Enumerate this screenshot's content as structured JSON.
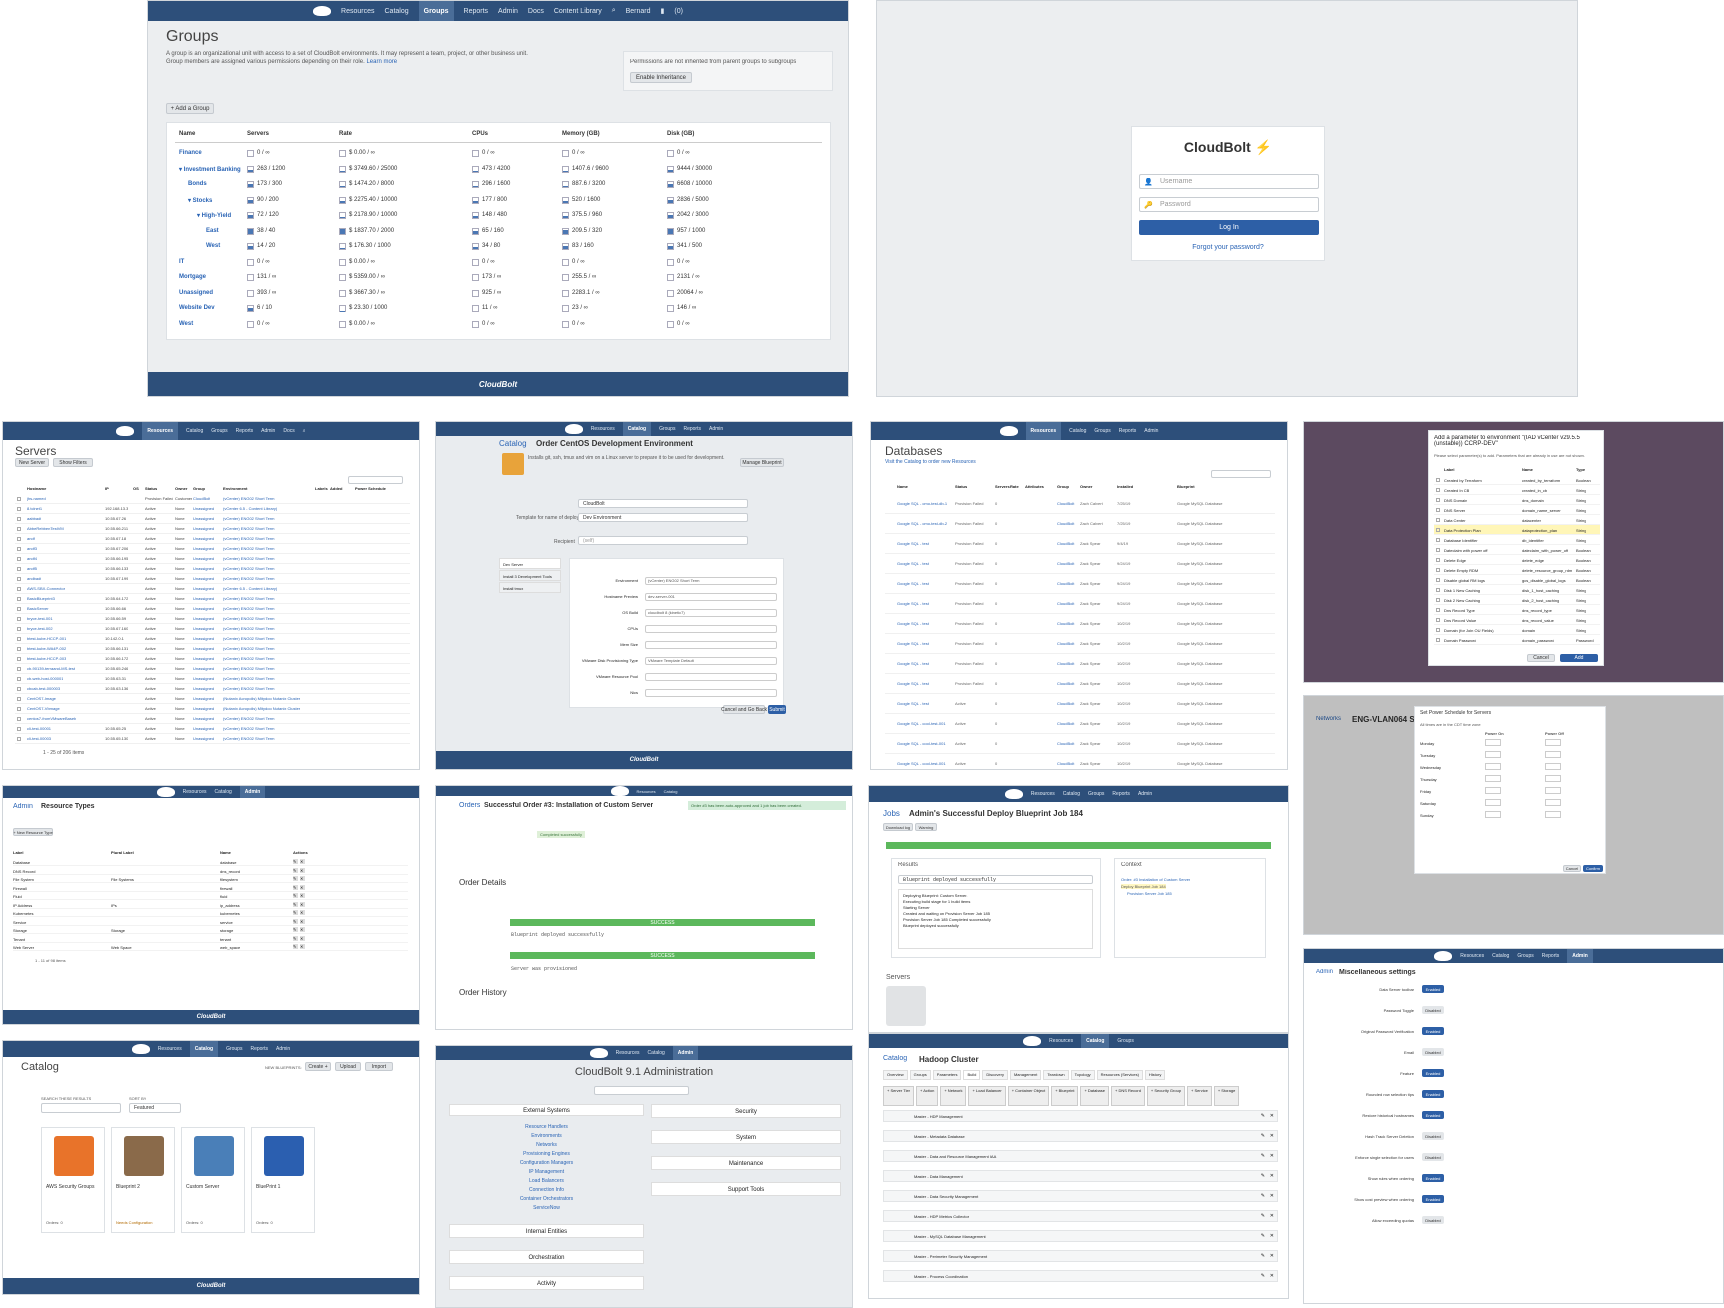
{
  "groups": {
    "nav": [
      "Resources",
      "Catalog",
      "Groups",
      "Reports",
      "Admin",
      "Docs",
      "Content Library",
      "Bernard",
      "(0)"
    ],
    "title": "Groups",
    "desc": "A group is an organizational unit with access to a set of CloudBolt environments. It may represent a team, project, or other business unit. Group members are assigned various permissions depending on their role.",
    "learn_more": "Learn more",
    "perm_note": "Permissions are not inherited from parent groups to subgroups",
    "enable_label": "Enable Inheritance",
    "add_label": "+ Add a Group",
    "headers": [
      "Name",
      "Servers",
      "Rate",
      "CPUs",
      "Memory (GB)",
      "Disk (GB)"
    ],
    "rows": [
      {
        "name": "Finance",
        "indent": 0,
        "servers": "0 / ∞",
        "rate": "$ 0.00 / ∞",
        "cpus": "0 / ∞",
        "mem": "0 / ∞",
        "disk": "0 / ∞"
      },
      {
        "name": "▾ Investment Banking",
        "indent": 0,
        "servers": "263 / 1200",
        "rate": "$ 3749.60 / 25000",
        "cpus": "473 / 4200",
        "mem": "1407.6 / 9600",
        "disk": "9444 / 30000"
      },
      {
        "name": "Bonds",
        "indent": 1,
        "servers": "173 / 300",
        "rate": "$ 1474.20 / 8000",
        "cpus": "296 / 1600",
        "mem": "887.6 / 3200",
        "disk": "6608 / 10000"
      },
      {
        "name": "▾ Stocks",
        "indent": 1,
        "servers": "90 / 200",
        "rate": "$ 2275.40 / 10000",
        "cpus": "177 / 800",
        "mem": "520 / 1600",
        "disk": "2836 / 5000"
      },
      {
        "name": "▾ High-Yield",
        "indent": 2,
        "servers": "72 / 120",
        "rate": "$ 2178.90 / 10000",
        "cpus": "148 / 480",
        "mem": "375.5 / 960",
        "disk": "2042 / 3000"
      },
      {
        "name": "East",
        "indent": 3,
        "servers": "38 / 40",
        "rate": "$ 1837.70 / 2000",
        "cpus": "65 / 160",
        "mem": "209.5 / 320",
        "disk": "957 / 1000"
      },
      {
        "name": "West",
        "indent": 3,
        "servers": "14 / 20",
        "rate": "$ 176.30 / 1000",
        "cpus": "34 / 80",
        "mem": "83 / 160",
        "disk": "341 / 500"
      },
      {
        "name": "IT",
        "indent": 0,
        "servers": "0 / ∞",
        "rate": "$ 0.00 / ∞",
        "cpus": "0 / ∞",
        "mem": "0 / ∞",
        "disk": "0 / ∞"
      },
      {
        "name": "Mortgage",
        "indent": 0,
        "servers": "131 / ∞",
        "rate": "$ 5359.00 / ∞",
        "cpus": "173 / ∞",
        "mem": "255.5 / ∞",
        "disk": "2131 / ∞"
      },
      {
        "name": "Unassigned",
        "indent": 0,
        "servers": "393 / ∞",
        "rate": "$ 3667.30 / ∞",
        "cpus": "925 / ∞",
        "mem": "2283.1 / ∞",
        "disk": "20064 / ∞"
      },
      {
        "name": "Website Dev",
        "indent": 0,
        "servers": "6 / 10",
        "rate": "$ 23.30 / 1000",
        "cpus": "11 / ∞",
        "mem": "23 / ∞",
        "disk": "146 / ∞"
      },
      {
        "name": "West",
        "indent": 0,
        "servers": "0 / ∞",
        "rate": "$ 0.00 / ∞",
        "cpus": "0 / ∞",
        "mem": "0 / ∞",
        "disk": "0 / ∞"
      }
    ],
    "footer": "CloudBolt"
  },
  "login": {
    "brand": "CloudBolt",
    "username": "Username",
    "password": "Password",
    "submit": "Log In",
    "forgot": "Forgot your password?"
  },
  "servers": {
    "title": "Servers",
    "new": "New Server",
    "filters": "Show Filters",
    "pager": "1 - 25 of 206 items",
    "cols": [
      "Hostname",
      "IP",
      "OS",
      "Status",
      "Owner",
      "Group",
      "Environment",
      "Labels",
      "Added",
      "Power Schedule"
    ],
    "rows": [
      [
        "jhs-named",
        "",
        "",
        "Provision Failed",
        "Customer",
        "CloudBolt",
        "(vCenter) ENG02 Short Term"
      ],
      [
        "8.tclnet1",
        "192.168.13.3",
        "",
        "Active",
        "None",
        "Unassigned",
        "(vCenter 6.5 - Content Library)"
      ],
      [
        "aabbadf",
        "10.55.67.26",
        "",
        "Active",
        "None",
        "Unassigned",
        "(vCenter) ENG02 Short Term"
      ],
      [
        "AbbeRebbenTestVM",
        "10.55.66.211",
        "",
        "Active",
        "None",
        "Unassigned",
        "(vCenter) ENG02 Short Term"
      ],
      [
        "andf",
        "10.55.67.18",
        "",
        "Active",
        "None",
        "Unassigned",
        "(vCenter) ENG02 Short Term"
      ],
      [
        "andf3",
        "10.55.67.206",
        "",
        "Active",
        "None",
        "Unassigned",
        "(vCenter) ENG02 Short Term"
      ],
      [
        "andf4",
        "10.55.66.195",
        "",
        "Active",
        "None",
        "Unassigned",
        "(vCenter) ENG02 Short Term"
      ],
      [
        "andf5",
        "10.55.66.133",
        "",
        "Active",
        "None",
        "Unassigned",
        "(vCenter) ENG02 Short Term"
      ],
      [
        "andbadf",
        "10.55.67.199",
        "",
        "Active",
        "None",
        "Unassigned",
        "(vCenter) ENG02 Short Term"
      ],
      [
        "AWS-SBX-Connector",
        "",
        "",
        "Active",
        "None",
        "Unassigned",
        "(vCenter 6.5 - Content Library)"
      ],
      [
        "BasicBlueprint3",
        "10.55.64.172",
        "",
        "Active",
        "None",
        "Unassigned",
        "(vCenter) ENG02 Short Term"
      ],
      [
        "BasicServer",
        "10.55.66.66",
        "",
        "Active",
        "None",
        "Unassigned",
        "(vCenter) ENG02 Short Term"
      ],
      [
        "bryce-test-001",
        "10.55.66.59",
        "",
        "Active",
        "None",
        "Unassigned",
        "(vCenter) ENG02 Short Term"
      ],
      [
        "bryce-test-002",
        "10.55.67.160",
        "",
        "Active",
        "None",
        "Unassigned",
        "(vCenter) ENG02 Short Term"
      ],
      [
        "btest-kube-HCCP-001",
        "10.142.0.1",
        "",
        "Active",
        "None",
        "Unassigned",
        "(vCenter) ENG02 Short Term"
      ],
      [
        "btest-kube-WA4P-002",
        "10.55.66.131",
        "",
        "Active",
        "None",
        "Unassigned",
        "(vCenter) ENG02 Short Term"
      ],
      [
        "btest-kube-HCCP-003",
        "10.55.66.172",
        "",
        "Active",
        "None",
        "Unassigned",
        "(vCenter) ENG02 Short Term"
      ],
      [
        "cb-90139-terraand-MS-test",
        "10.55.65.246",
        "",
        "Active",
        "None",
        "Unassigned",
        "(vCenter) ENG02 Short Term"
      ],
      [
        "cb-web-host-000001",
        "10.55.63.31",
        "",
        "Active",
        "None",
        "Unassigned",
        "(vCenter) ENG02 Short Term"
      ],
      [
        "cbcab-test-000003",
        "10.55.63.136",
        "",
        "Active",
        "None",
        "Unassigned",
        "(vCenter) ENG02 Short Term"
      ],
      [
        "CentOS7-Image",
        "",
        "",
        "Active",
        "None",
        "Unassigned",
        "(Nutanix Acropolis) Mitydoo Nutanix Cluster"
      ],
      [
        "CentOS7-Vbmage",
        "",
        "",
        "Active",
        "None",
        "Unassigned",
        "(Nutanix Acropolis) Mitydoo Nutanix Cluster"
      ],
      [
        "centos7-fromVMwareBaseb",
        "",
        "",
        "Active",
        "None",
        "Unassigned",
        "(vCenter) ENG02 Short Term"
      ],
      [
        "cli-test-00001",
        "10.55.65.25",
        "",
        "Active",
        "None",
        "Unassigned",
        "(vCenter) ENG02 Short Term"
      ],
      [
        "cli-test-00003",
        "10.55.65.130",
        "",
        "Active",
        "None",
        "Unassigned",
        "(vCenter) ENG02 Short Term"
      ]
    ]
  },
  "order": {
    "crumb": "Catalog",
    "title": "Order CentOS Development Environment",
    "desc": "Installs git, ssh, tmux and vim on a Linux server to prepare it to be used for development.",
    "manage": "Manage Blueprint",
    "group_label": "Group",
    "group_val": "CloudBolt",
    "template_label": "Template for name of deployed Service",
    "template_val": "Dev Environment",
    "recipient_label": "Recipient",
    "recipient_val": "(self)",
    "steps": [
      "Dev Server",
      "Install 3 Development Tools",
      "Install tmux"
    ],
    "fields": [
      "Environment",
      "Hostname Preview",
      "OS Build",
      "CPUs",
      "Mem Size",
      "VMware Disk Provisioning Type",
      "VMware Resource Pool",
      "Nics"
    ],
    "values": [
      "(vCenter) ENG02 Short Term",
      "dev-server-001",
      "cloudbolt 8 (kinetic7)",
      "",
      "",
      "VMware Template Default",
      "",
      ""
    ],
    "cancel": "Cancel and Go Back",
    "submit": "Submit"
  },
  "databases": {
    "title": "Databases",
    "hint": "Visit the Catalog to order new Resources",
    "cols": [
      "Name",
      "Status",
      "Servers",
      "Rate",
      "Attributes",
      "Group",
      "Owner",
      "Installed",
      "Blueprint"
    ],
    "rows": [
      [
        "Google SQL - cmo-test-db-1",
        "Provision Failed",
        "0",
        "CloudBolt",
        "Zach Calvert",
        "7/25/19",
        "Google MySQL Database"
      ],
      [
        "Google SQL - cmo-test-db-2",
        "Provision Failed",
        "0",
        "CloudBolt",
        "Zach Calvert",
        "7/25/19",
        "Google MySQL Database"
      ],
      [
        "Google SQL - test",
        "Provision Failed",
        "0",
        "CloudBolt",
        "Zack Spear",
        "9/4/19",
        "Google MySQL Database"
      ],
      [
        "Google SQL - test",
        "Provision Failed",
        "0",
        "CloudBolt",
        "Zack Spear",
        "9/24/19",
        "Google MySQL Database"
      ],
      [
        "Google SQL - test",
        "Provision Failed",
        "0",
        "CloudBolt",
        "Zack Spear",
        "9/24/19",
        "Google MySQL Database"
      ],
      [
        "Google SQL - test",
        "Provision Failed",
        "0",
        "CloudBolt",
        "Zack Spear",
        "9/24/19",
        "Google MySQL Database"
      ],
      [
        "Google SQL - test",
        "Provision Failed",
        "0",
        "CloudBolt",
        "Zack Spear",
        "10/2/19",
        "Google MySQL Database"
      ],
      [
        "Google SQL - test",
        "Provision Failed",
        "0",
        "CloudBolt",
        "Zack Spear",
        "10/2/19",
        "Google MySQL Database"
      ],
      [
        "Google SQL - test",
        "Provision Failed",
        "0",
        "CloudBolt",
        "Zack Spear",
        "10/2/19",
        "Google MySQL Database"
      ],
      [
        "Google SQL - test",
        "Provision Failed",
        "0",
        "CloudBolt",
        "Zack Spear",
        "10/2/19",
        "Google MySQL Database"
      ],
      [
        "Google SQL - test",
        "Active",
        "0",
        "CloudBolt",
        "Zack Spear",
        "10/2/19",
        "Google MySQL Database"
      ],
      [
        "Google SQL - cool-test-001",
        "Active",
        "0",
        "CloudBolt",
        "Zack Spear",
        "10/2/19",
        "Google MySQL Database"
      ],
      [
        "Google SQL - cool-test-001",
        "Active",
        "0",
        "CloudBolt",
        "Zack Spear",
        "10/2/19",
        "Google MySQL Database"
      ],
      [
        "Google SQL - cool-test-001",
        "Active",
        "0",
        "CloudBolt",
        "Zack Spear",
        "10/2/19",
        "Google MySQL Database"
      ]
    ]
  },
  "param_modal": {
    "title": "Add a parameter to environment \"(IAD vCenter v29.5.5 (unstable)) CCRP-DEV\"",
    "hint": "Please select parameter(s) to add. Parameters that are already in use are not shown.",
    "cols": [
      "Label",
      "Name",
      "Type"
    ],
    "rows": [
      [
        "Created by Terraform",
        "created_by_terraform",
        "Boolean"
      ],
      [
        "Created In CB",
        "created_in_cb",
        "String"
      ],
      [
        "DNS Domain",
        "dns_domain",
        "String"
      ],
      [
        "DNS Server",
        "domain_name_server",
        "String"
      ],
      [
        "Data Center",
        "datacenter",
        "String"
      ],
      [
        "Data Protection Plan",
        "dataprotection_plan",
        "String"
      ],
      [
        "Database Identifier",
        "db_identifier",
        "String"
      ],
      [
        "Dateclaim with power off",
        "dateclaim_with_power_off",
        "Boolean"
      ],
      [
        "Delete Edge",
        "delete_edge",
        "Boolean"
      ],
      [
        "Delete Empty RDM",
        "delete_resource_group_rdm",
        "Boolean"
      ],
      [
        "Disable global RM logs",
        "gcs_disable_global_logs",
        "Boolean"
      ],
      [
        "Disk 1 New Caching",
        "disk_1_host_caching",
        "String"
      ],
      [
        "Disk 2 New Caching",
        "disk_2_host_caching",
        "String"
      ],
      [
        "Dns Record Type",
        "dns_record_type",
        "String"
      ],
      [
        "Dns Record Value",
        "dns_record_value",
        "String"
      ],
      [
        "Domain (for Join OU Fields)",
        "domain",
        "String"
      ],
      [
        "Domain Password",
        "domain_password",
        "Password"
      ]
    ],
    "cancel": "Cancel",
    "add": "Add",
    "env": "Environments",
    "env_title": "(IAD vCenter"
  },
  "resource_types": {
    "crumb": "Admin",
    "title": "Resource Types",
    "new": "+ New Resource Type",
    "cols": [
      "Label",
      "Plural Label",
      "Name",
      "Actions"
    ],
    "rows": [
      [
        "Database",
        "",
        "database"
      ],
      [
        "DNS Record",
        "",
        "dns_record"
      ],
      [
        "File System",
        "File Systems",
        "filesystem"
      ],
      [
        "Firewall",
        "",
        "firewall"
      ],
      [
        "Fluid",
        "",
        "fluid"
      ],
      [
        "IP Address",
        "IPs",
        "ip_address"
      ],
      [
        "Kubernetes",
        "",
        "kubernetes"
      ],
      [
        "Service",
        "",
        "service"
      ],
      [
        "Storage",
        "Storage",
        "storage"
      ],
      [
        "Tenant",
        "",
        "tenant"
      ],
      [
        "Web Server",
        "Web Space",
        "web_space"
      ]
    ],
    "pager": "1 - 11 of 98 items"
  },
  "order3": {
    "crumb": "Orders",
    "title": "Successful Order #3: Installation of Custom Server",
    "toast": "Order #3 has been auto-approved and 1 job has been created.",
    "status": "Completed successfully",
    "details": "Order Details",
    "history": "Order History",
    "progress": "SUCCESS",
    "output1": "Blueprint deployed successfully",
    "output2": "Server was provisioned"
  },
  "job": {
    "crumb": "Jobs",
    "title": "Admin's Successful Deploy Blueprint Job 184",
    "tabs": [
      "Download log",
      "Warning"
    ],
    "results": "Results",
    "context": "Context",
    "output": "Blueprint deployed successfully",
    "log": [
      "Deploying Blueprint: Custom Server.",
      "Executing build stage for 1 build items",
      "Starting Server",
      "Created and waiting on Provision Server Job 185",
      "Provision Server Job 185 Completed successfully",
      "Blueprint deployed successfully"
    ],
    "servers": "Servers",
    "ctx1": "Order: #3 Installation of Custom Server",
    "ctx2": "Deploy Blueprint Job 184",
    "ctx3": "Provision Server Job 185"
  },
  "power": {
    "title": "Set Power Schedule for Servers",
    "tz": "All times are in the CDT time zone",
    "days": [
      "Monday",
      "Tuesday",
      "Wednesday",
      "Thursday",
      "Friday",
      "Saturday",
      "Sunday"
    ],
    "on": "Power On",
    "off": "Power Off",
    "cancel": "Cancel",
    "confirm": "Confirm",
    "bg_title": "ENG-VLAN064 Short",
    "crumb": "Networks"
  },
  "catalog": {
    "title": "Catalog",
    "new_bp": "NEW BLUEPRINTS:",
    "create": "Create +",
    "upload": "Upload",
    "import": "Import",
    "search_label": "SEARCH THESE RESULTS",
    "sort_label": "SORT BY",
    "sort_val": "Featured",
    "items": [
      {
        "name": "AWS Security Groups",
        "orders": "Orders: 0"
      },
      {
        "name": "Blueprint 2",
        "orders": "Needs Configuration"
      },
      {
        "name": "Custom Server",
        "orders": "Orders: 0"
      },
      {
        "name": "BluePrint 1",
        "orders": "Orders: 0"
      }
    ]
  },
  "admin": {
    "title": "CloudBolt 9.1 Administration",
    "left": [
      "External Systems",
      "Internal Entities",
      "Orchestration",
      "Activity"
    ],
    "links": [
      "Resource Handlers",
      "Environments",
      "Networks",
      "Provisioning Engines",
      "Configuration Managers",
      "IP Management",
      "Load Balancers",
      "Connection Info",
      "Container Orchestrators",
      "ServiceNow"
    ],
    "right": [
      "Security",
      "System",
      "Maintenance",
      "Support Tools"
    ]
  },
  "hadoop": {
    "crumb": "Catalog",
    "title": "Hadoop Cluster",
    "tabs": [
      "Overview",
      "Groups",
      "Parameters",
      "Build",
      "Discovery",
      "Management",
      "Teardown",
      "Topology",
      "Resources (Services)",
      "History"
    ],
    "items": [
      "Master - HDP Management",
      "Master - Metadata Database",
      "Master - Data and Resource Management IAA",
      "Master - Data Management",
      "Master - Data Security Management",
      "Master - HDP Metrics Collector",
      "Master - MySQL Database Management",
      "Master - Perimeter Security Management",
      "Master - Process Coordination"
    ],
    "buttons": [
      "+ Server Tier",
      "+ Action",
      "+ Network",
      "+ Load Balancer",
      "+ Container Object",
      "+ Blueprint",
      "+ Database",
      "+ DNS Record",
      "+ Security Group",
      "+ Service",
      "+ Storage"
    ]
  },
  "misc": {
    "crumb": "Admin",
    "title": "Miscellaneous settings",
    "rows": [
      [
        "Data Server toolbar",
        "Enabled"
      ],
      [
        "Password Toggle",
        "Disabled"
      ],
      [
        "Original Password Verification",
        "Enabled"
      ],
      [
        "Email",
        "Disabled"
      ],
      [
        "Feature",
        "Enabled"
      ],
      [
        "Rounded row selection tips",
        "Enabled"
      ],
      [
        "Restore historical hostnames",
        "Enabled"
      ],
      [
        "Hash Track Server Deletion",
        "Disabled"
      ],
      [
        "Enforce single selection for users",
        "Disabled"
      ],
      [
        "Show rules when ordering",
        "Enabled"
      ],
      [
        "Show cost preview when ordering",
        "Enabled"
      ],
      [
        "Allow exceeding quotas",
        "Disabled"
      ]
    ]
  }
}
